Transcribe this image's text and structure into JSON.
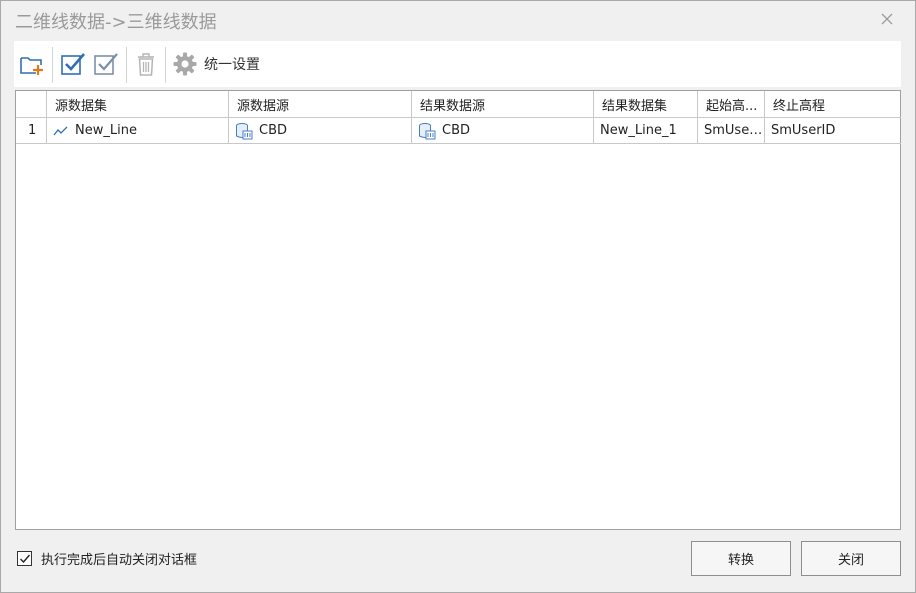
{
  "window": {
    "title": "二维线数据->三维线数据"
  },
  "toolbar": {
    "add_icon": "folder-add-icon",
    "select_all_icon": "check-all-icon",
    "invert_select_icon": "check-invert-icon",
    "delete_icon": "trash-icon",
    "settings_icon": "gear-icon",
    "settings_label": "统一设置"
  },
  "table": {
    "columns": [
      "",
      "源数据集",
      "源数据源",
      "结果数据源",
      "结果数据集",
      "起始高...",
      "终止高程"
    ],
    "rows": [
      {
        "index": "1",
        "source_dataset": "New_Line",
        "source_datasource": "CBD",
        "result_datasource": "CBD",
        "result_dataset": "New_Line_1",
        "start_height": "SmUser...",
        "end_height": "SmUserID"
      }
    ]
  },
  "footer": {
    "auto_close_label": "执行完成后自动关闭对话框",
    "auto_close_checked": true,
    "convert_label": "转换",
    "close_label": "关闭"
  },
  "colors": {
    "accent_blue": "#2f6fb3",
    "orange_plus": "#e07b1a",
    "disabled_gray": "#b5b5b5"
  }
}
